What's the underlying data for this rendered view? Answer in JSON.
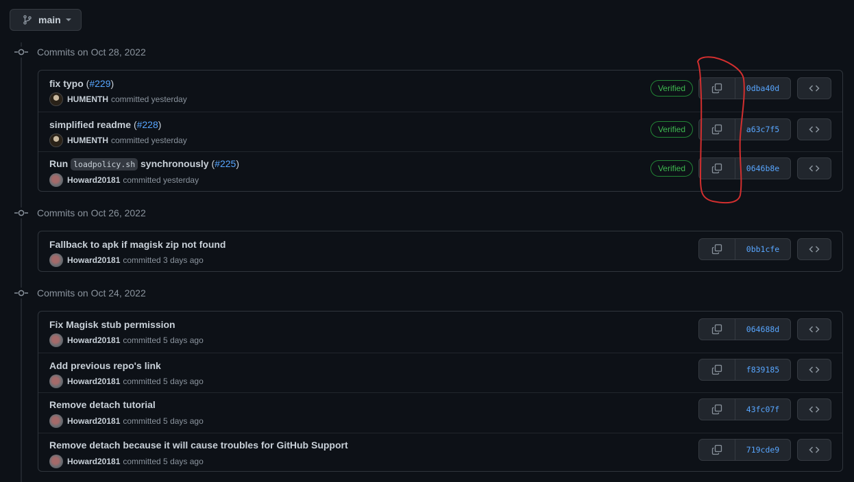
{
  "branch": {
    "name": "main",
    "icon": "git-branch-icon"
  },
  "groups": [
    {
      "date": "Commits on Oct 28, 2022",
      "commits": [
        {
          "title": "fix typo",
          "pr": "#229",
          "author": "HUMENTH",
          "time": "committed yesterday",
          "verified": "Verified",
          "sha": "0dba40d"
        },
        {
          "title": "simplified readme",
          "pr": "#228",
          "author": "HUMENTH",
          "time": "committed yesterday",
          "verified": "Verified",
          "sha": "a63c7f5"
        },
        {
          "title_before": "Run",
          "title_code": "loadpolicy.sh",
          "title_after": "synchronously",
          "pr": "#225",
          "author": "Howard20181",
          "time": "committed yesterday",
          "verified": "Verified",
          "sha": "0646b8e"
        }
      ]
    },
    {
      "date": "Commits on Oct 26, 2022",
      "commits": [
        {
          "title": "Fallback to apk if magisk zip not found",
          "author": "Howard20181",
          "time": "committed 3 days ago",
          "sha": "0bb1cfe"
        }
      ]
    },
    {
      "date": "Commits on Oct 24, 2022",
      "commits": [
        {
          "title": "Fix Magisk stub permission",
          "author": "Howard20181",
          "time": "committed 5 days ago",
          "sha": "064688d"
        },
        {
          "title": "Add previous repo's link",
          "author": "Howard20181",
          "time": "committed 5 days ago",
          "sha": "f839185"
        },
        {
          "title": "Remove detach tutorial",
          "author": "Howard20181",
          "time": "committed 5 days ago",
          "sha": "43fc07f"
        },
        {
          "title": "Remove detach because it will cause troubles for GitHub Support",
          "author": "Howard20181",
          "time": "committed 5 days ago",
          "sha": "719cde9"
        }
      ]
    }
  ],
  "colors": {
    "background": "#0d1117",
    "link": "#58a6ff",
    "verified": "#3fb950",
    "annotation": "#d32f2f"
  },
  "icons": [
    "git-branch-icon",
    "git-commit-icon",
    "copy-icon",
    "code-icon"
  ]
}
